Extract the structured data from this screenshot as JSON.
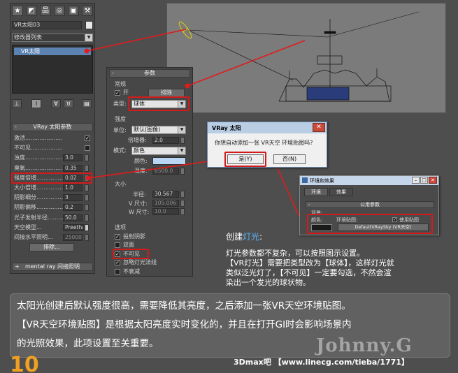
{
  "left_panel": {
    "object_name": "VR太阳03",
    "modifier_list": "修改器列表",
    "stack_item": "VR太阳",
    "vray_sun_rollout": "VRay 太阳参数",
    "params": [
      {
        "label": "激活......................",
        "type": "check",
        "checked": true
      },
      {
        "label": "不可见...................",
        "type": "check",
        "checked": false
      },
      {
        "label": "浊度......................",
        "value": "3.0"
      },
      {
        "label": "臭氧......................",
        "value": "0.35"
      },
      {
        "label": "强度倍增...............",
        "value": "0.02"
      },
      {
        "label": "大小倍增...............",
        "value": "1.0"
      },
      {
        "label": "阴影细分...............",
        "value": "3"
      },
      {
        "label": "阴影偏移...............",
        "value": "0.2"
      },
      {
        "label": "光子发射半径..........",
        "value": "50.0"
      },
      {
        "label": "天空模型...",
        "value": "Preetham et"
      },
      {
        "label": "间接水平照明...",
        "value": "25000"
      }
    ],
    "exclude_button": "排除...",
    "mental_ray_rollout": "mental ray 间接照明"
  },
  "mid_panel": {
    "title": "参数",
    "general_group": "常规",
    "on_label": "开",
    "exclude_label": "排除",
    "type_label": "类型:",
    "type_value": "球体",
    "intensity_group": "强度",
    "unit_label": "单位:",
    "unit_value": "默认(图像)",
    "multiplier_label": "倍增器:",
    "multiplier_value": "2.0",
    "mode_label": "模式:",
    "mode_value": "颜色",
    "color_label": "颜色:",
    "temperature_label": "温度:",
    "temperature_value": "6500.0",
    "size_group": "大小",
    "radius_label": "半径:",
    "radius_value": "30.567",
    "vsize_label": "V 尺寸:",
    "vsize_value": "105.006",
    "wsize_label": "W 尺寸:",
    "wsize_value": "10.0",
    "options_group": "选项",
    "options": [
      {
        "label": "投射阴影",
        "checked": true
      },
      {
        "label": "双面",
        "checked": false
      },
      {
        "label": "不可见",
        "checked": true
      },
      {
        "label": "忽略灯光法线",
        "checked": true
      },
      {
        "label": "不衰减",
        "checked": false
      }
    ]
  },
  "dialog_sun": {
    "title": "VRay 太阳",
    "message": "你想自动添加一张 VR天空 环境贴图吗?",
    "yes": "是(Y)",
    "no": "否(N)"
  },
  "dialog_env": {
    "title": "环境和效果",
    "tab_env": "环境",
    "tab_effects": "效果",
    "section": "公用参数",
    "background": "背景:",
    "color_label": "颜色:",
    "env_map_label": "环境贴图:",
    "use_map": "使用贴图",
    "map_button": "DefaultVRaySky (VR天空)"
  },
  "caption": {
    "create_prefix": "创建",
    "create_highlight": "灯光",
    "create_suffix": ":",
    "line1": "灯光参数都不复杂，可以按照图示设置。",
    "line2": "【VR灯光】需要把类型改为【球体】，这样灯光就",
    "line3": "类似泛光灯了，【不可见】一定要勾选，不然会渲",
    "line4": "染出一个发光的球状物。"
  },
  "bottom": {
    "line1": "太阳光创建后默认强度很高，需要降低其亮度，之后添加一张VR天空环境贴图。",
    "line2": "【VR天空环境贴图】是根据太阳亮度实时变化的，并且在打开GI时会影响场景内",
    "line3": "的光照效果，此项设置至关重要。",
    "watermark": "Johnny.G",
    "site": "3Dmax吧 【www.linecg.com/tieba/1771】",
    "step": "10"
  }
}
